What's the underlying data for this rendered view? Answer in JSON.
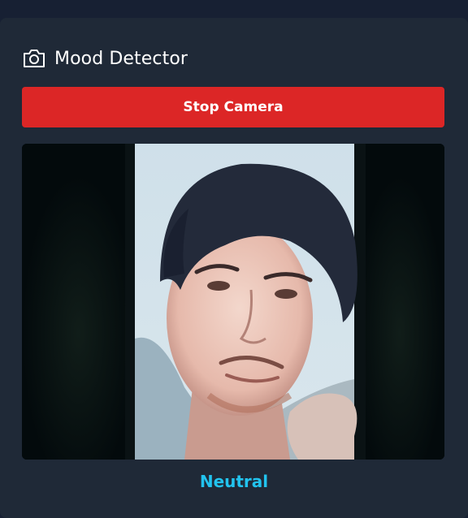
{
  "header": {
    "icon": "camera-icon",
    "title": "Mood Detector"
  },
  "controls": {
    "stop_camera_label": "Stop Camera",
    "stop_color": "#dc2626"
  },
  "video": {
    "description_icon": "camera-feed"
  },
  "result": {
    "mood": "Neutral",
    "mood_color": "#22c3ee"
  }
}
